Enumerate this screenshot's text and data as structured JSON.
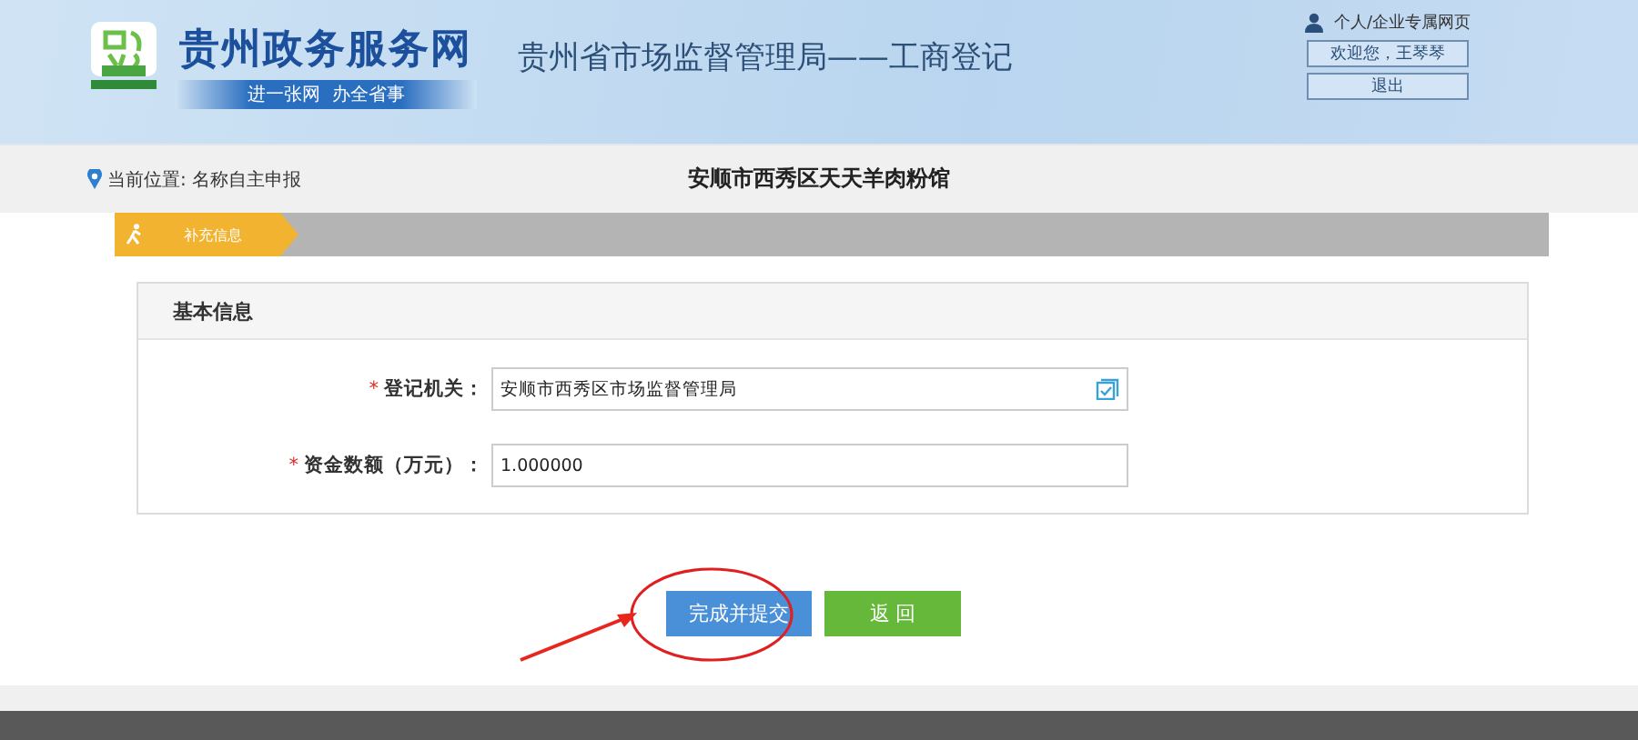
{
  "header": {
    "site_name": "贵州政务服务网",
    "slogan": "进一张网  办全省事",
    "system_title": "贵州省市场监督管理局——工商登记",
    "user_link": "个人/企业专属网页",
    "welcome": "欢迎您，王琴琴",
    "logout": "退出"
  },
  "breadcrumb": {
    "location": "当前位置: 名称自主申报",
    "company": "安顺市西秀区天天羊肉粉馆"
  },
  "steps": [
    {
      "label": "补充信息",
      "selected": true
    }
  ],
  "section": {
    "title": "基本信息",
    "fields": [
      {
        "label": "登记机关：",
        "required_mark": "*",
        "value": "安顺市西秀区市场监督管理局",
        "kind": "picker"
      },
      {
        "label": "资金数额（万元）：",
        "required_mark": "*",
        "value": "1.000000",
        "kind": "text"
      }
    ]
  },
  "buttons": [
    {
      "label": "完成并提交",
      "kind": "primary",
      "highlighted": true
    },
    {
      "label": "返 回",
      "kind": "success",
      "highlighted": false
    }
  ]
}
